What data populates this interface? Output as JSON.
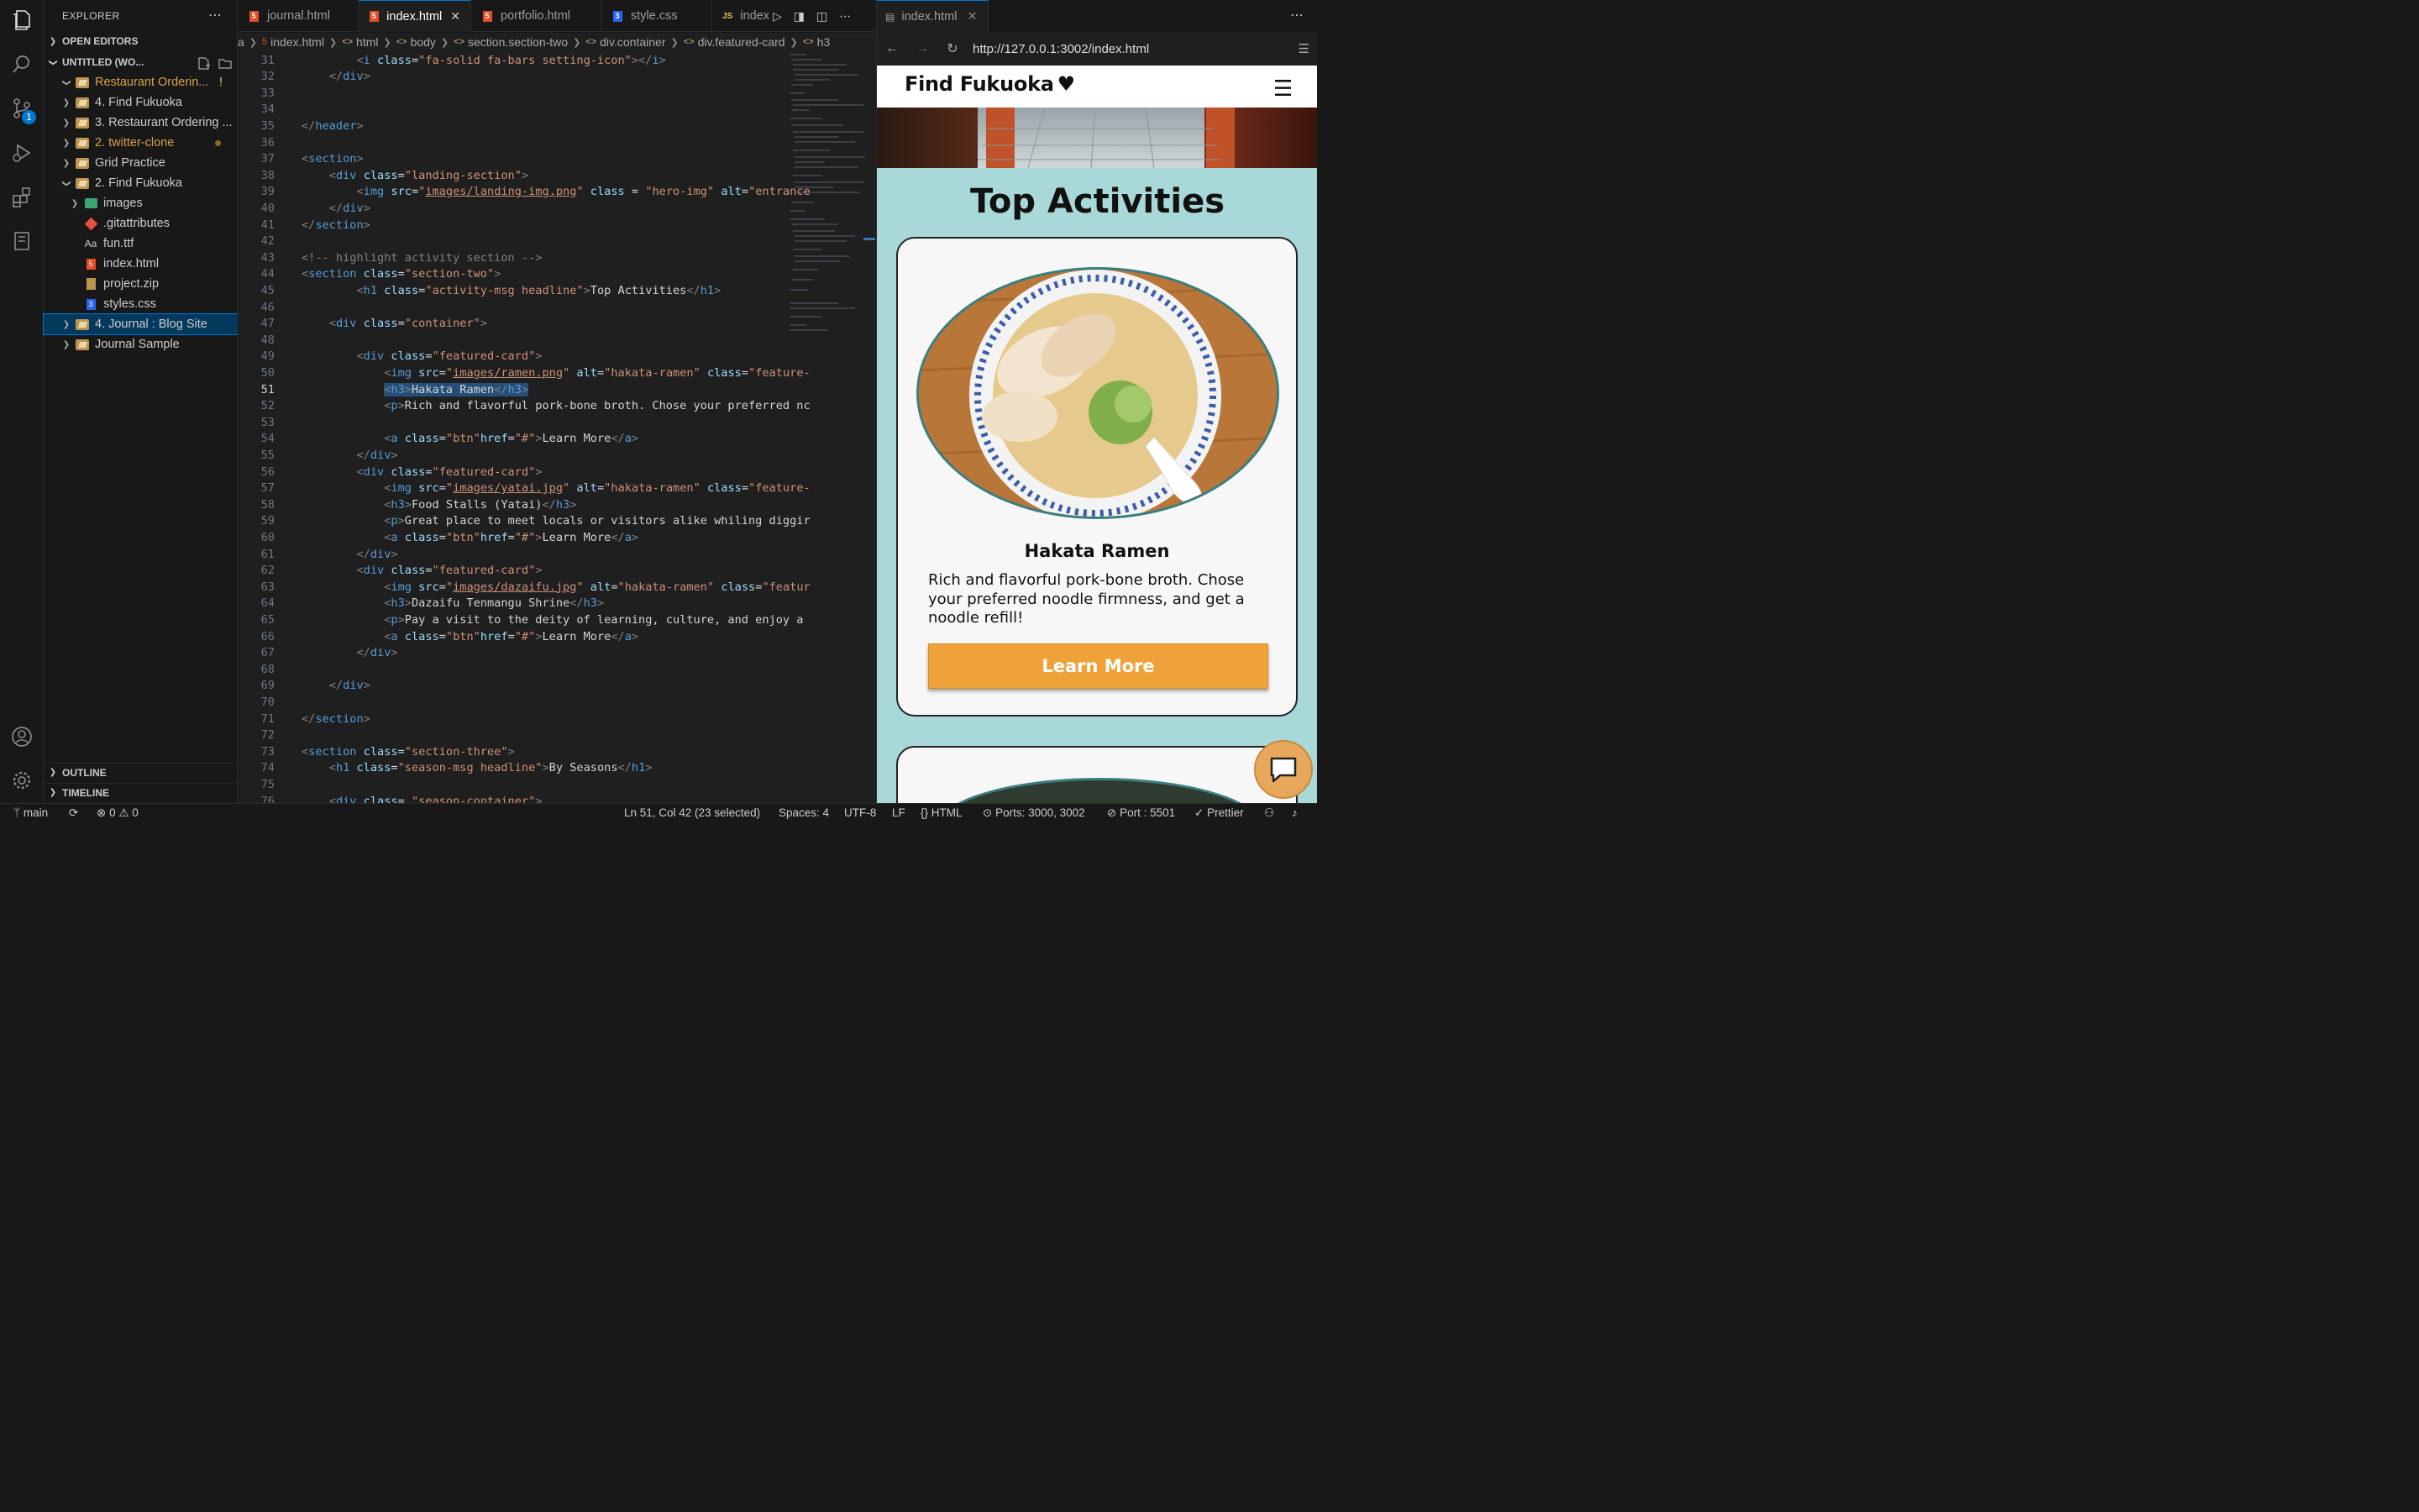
{
  "sidebar": {
    "title": "EXPLORER",
    "open_editors": "OPEN EDITORS",
    "workspace": "UNTITLED (WO...",
    "items": [
      {
        "label": "Restaurant Orderin...",
        "status": "!"
      },
      {
        "label": "4. Find Fukuoka"
      },
      {
        "label": "3. Restaurant Ordering ..."
      },
      {
        "label": "2. twitter-clone"
      },
      {
        "label": "Grid Practice"
      },
      {
        "label": "2. Find Fukuoka"
      },
      {
        "label": "images"
      },
      {
        "label": ".gitattributes"
      },
      {
        "label": "fun.ttf"
      },
      {
        "label": "index.html"
      },
      {
        "label": "project.zip"
      },
      {
        "label": "styles.css"
      },
      {
        "label": "4. Journal : Blog Site"
      },
      {
        "label": "Journal Sample"
      }
    ],
    "outline": "OUTLINE",
    "timeline": "TIMELINE",
    "source_control_badge": "1"
  },
  "tabs": [
    {
      "label": "journal.html",
      "icon": "html-icon"
    },
    {
      "label": "index.html",
      "icon": "html-icon",
      "active": true
    },
    {
      "label": "portfolio.html",
      "icon": "html-icon"
    },
    {
      "label": "style.css",
      "icon": "css-icon"
    },
    {
      "label": "index",
      "icon": "js-icon",
      "prefix": "JS"
    }
  ],
  "breadcrumbs": [
    "a",
    "index.html",
    "html",
    "body",
    "section.section-two",
    "div.container",
    "div.featured-card",
    "h3"
  ],
  "editor": {
    "lines": [
      {
        "n": 31,
        "html": "        <span class=\"t\">&lt;</span><span class=\"tg\">i</span> <span class=\"at\">class</span><span class=\"tx\">=</span><span class=\"st\">\"fa-solid fa-bars setting-icon\"</span><span class=\"t\">&gt;&lt;/</span><span class=\"tg\">i</span><span class=\"t\">&gt;</span>"
      },
      {
        "n": 32,
        "html": "    <span class=\"t\">&lt;/</span><span class=\"tg\">div</span><span class=\"t\">&gt;</span>"
      },
      {
        "n": 33,
        "html": ""
      },
      {
        "n": 34,
        "html": ""
      },
      {
        "n": 35,
        "html": "<span class=\"t\">&lt;/</span><span class=\"tg\">header</span><span class=\"t\">&gt;</span>"
      },
      {
        "n": 36,
        "html": ""
      },
      {
        "n": 37,
        "html": "<span class=\"t\">&lt;</span><span class=\"tg\">section</span><span class=\"t\">&gt;</span>"
      },
      {
        "n": 38,
        "html": "    <span class=\"t\">&lt;</span><span class=\"tg\">div</span> <span class=\"at\">class</span><span class=\"tx\">=</span><span class=\"st\">\"landing-section\"</span><span class=\"t\">&gt;</span>"
      },
      {
        "n": 39,
        "html": "        <span class=\"t\">&lt;</span><span class=\"tg\">img</span> <span class=\"at\">src</span><span class=\"tx\">=</span><span class=\"st\">\"</span><span class=\"lk\">images/landing-img.png</span><span class=\"st\">\"</span> <span class=\"at\">class</span> <span class=\"tx\">=</span> <span class=\"st\">\"hero-img\"</span> <span class=\"at\">alt</span><span class=\"tx\">=</span><span class=\"st\">\"entrance</span>"
      },
      {
        "n": 40,
        "html": "    <span class=\"t\">&lt;/</span><span class=\"tg\">div</span><span class=\"t\">&gt;</span>"
      },
      {
        "n": 41,
        "html": "<span class=\"t\">&lt;/</span><span class=\"tg\">section</span><span class=\"t\">&gt;</span>"
      },
      {
        "n": 42,
        "html": ""
      },
      {
        "n": 43,
        "html": "<span class=\"t\">&lt;!-- highlight activity section --&gt;</span>"
      },
      {
        "n": 44,
        "html": "<span class=\"t\">&lt;</span><span class=\"tg\">section</span> <span class=\"at\">class</span><span class=\"tx\">=</span><span class=\"st\">\"section-two\"</span><span class=\"t\">&gt;</span>"
      },
      {
        "n": 45,
        "html": "        <span class=\"t\">&lt;</span><span class=\"tg\">h1</span> <span class=\"at\">class</span><span class=\"tx\">=</span><span class=\"st\">\"activity-msg headline\"</span><span class=\"t\">&gt;</span><span class=\"tx\">Top Activities</span><span class=\"t\">&lt;/</span><span class=\"tg\">h1</span><span class=\"t\">&gt;</span>"
      },
      {
        "n": 46,
        "html": ""
      },
      {
        "n": 47,
        "html": "    <span class=\"t\">&lt;</span><span class=\"tg\">div</span> <span class=\"at\">class</span><span class=\"tx\">=</span><span class=\"st\">\"container\"</span><span class=\"t\">&gt;</span>"
      },
      {
        "n": 48,
        "html": ""
      },
      {
        "n": 49,
        "html": "        <span class=\"t\">&lt;</span><span class=\"tg\">div</span> <span class=\"at\">class</span><span class=\"tx\">=</span><span class=\"st\">\"featured-card\"</span><span class=\"t\">&gt;</span>"
      },
      {
        "n": 50,
        "html": "            <span class=\"t\">&lt;</span><span class=\"tg\">img</span> <span class=\"at\">src</span><span class=\"tx\">=</span><span class=\"st\">\"</span><span class=\"lk\">images/ramen.png</span><span class=\"st\">\"</span> <span class=\"at\">alt</span><span class=\"tx\">=</span><span class=\"st\">\"hakata-ramen\"</span> <span class=\"at\">class</span><span class=\"tx\">=</span><span class=\"st\">\"feature-</span>"
      },
      {
        "n": 51,
        "html": "            <span class=\"selbg\"><span class=\"t\">&lt;</span><span class=\"tg\">h3</span><span class=\"t\">&gt;</span><span class=\"tx\">Hakata Ramen</span><span class=\"t\">&lt;/</span><span class=\"tg\">h3</span><span class=\"t\">&gt;</span></span>",
        "current": true
      },
      {
        "n": 52,
        "html": "            <span class=\"t\">&lt;</span><span class=\"tg\">p</span><span class=\"t\">&gt;</span><span class=\"tx\">Rich and flavorful pork-bone broth. Chose your preferred nc</span>"
      },
      {
        "n": 53,
        "html": ""
      },
      {
        "n": 54,
        "html": "            <span class=\"t\">&lt;</span><span class=\"tg\">a</span> <span class=\"at\">class</span><span class=\"tx\">=</span><span class=\"st\">\"btn\"</span><span class=\"at\">href</span><span class=\"tx\">=</span><span class=\"st\">\"#\"</span><span class=\"t\">&gt;</span><span class=\"tx\">Learn More</span><span class=\"t\">&lt;/</span><span class=\"tg\">a</span><span class=\"t\">&gt;</span>"
      },
      {
        "n": 55,
        "html": "        <span class=\"t\">&lt;/</span><span class=\"tg\">div</span><span class=\"t\">&gt;</span>"
      },
      {
        "n": 56,
        "html": "        <span class=\"t\">&lt;</span><span class=\"tg\">div</span> <span class=\"at\">class</span><span class=\"tx\">=</span><span class=\"st\">\"featured-card\"</span><span class=\"t\">&gt;</span>"
      },
      {
        "n": 57,
        "html": "            <span class=\"t\">&lt;</span><span class=\"tg\">img</span> <span class=\"at\">src</span><span class=\"tx\">=</span><span class=\"st\">\"</span><span class=\"lk\">images/yatai.jpg</span><span class=\"st\">\"</span> <span class=\"at\">alt</span><span class=\"tx\">=</span><span class=\"st\">\"hakata-ramen\"</span> <span class=\"at\">class</span><span class=\"tx\">=</span><span class=\"st\">\"feature-</span>"
      },
      {
        "n": 58,
        "html": "            <span class=\"t\">&lt;</span><span class=\"tg\">h3</span><span class=\"t\">&gt;</span><span class=\"tx\">Food Stalls (Yatai)</span><span class=\"t\">&lt;/</span><span class=\"tg\">h3</span><span class=\"t\">&gt;</span>"
      },
      {
        "n": 59,
        "html": "            <span class=\"t\">&lt;</span><span class=\"tg\">p</span><span class=\"t\">&gt;</span><span class=\"tx\">Great place to meet locals or visitors alike whiling diggir</span>"
      },
      {
        "n": 60,
        "html": "            <span class=\"t\">&lt;</span><span class=\"tg\">a</span> <span class=\"at\">class</span><span class=\"tx\">=</span><span class=\"st\">\"btn\"</span><span class=\"at\">href</span><span class=\"tx\">=</span><span class=\"st\">\"#\"</span><span class=\"t\">&gt;</span><span class=\"tx\">Learn More</span><span class=\"t\">&lt;/</span><span class=\"tg\">a</span><span class=\"t\">&gt;</span>"
      },
      {
        "n": 61,
        "html": "        <span class=\"t\">&lt;/</span><span class=\"tg\">div</span><span class=\"t\">&gt;</span>"
      },
      {
        "n": 62,
        "html": "        <span class=\"t\">&lt;</span><span class=\"tg\">div</span> <span class=\"at\">class</span><span class=\"tx\">=</span><span class=\"st\">\"featured-card\"</span><span class=\"t\">&gt;</span>"
      },
      {
        "n": 63,
        "html": "            <span class=\"t\">&lt;</span><span class=\"tg\">img</span> <span class=\"at\">src</span><span class=\"tx\">=</span><span class=\"st\">\"</span><span class=\"lk\">images/dazaifu.jpg</span><span class=\"st\">\"</span> <span class=\"at\">alt</span><span class=\"tx\">=</span><span class=\"st\">\"hakata-ramen\"</span> <span class=\"at\">class</span><span class=\"tx\">=</span><span class=\"st\">\"featur</span>"
      },
      {
        "n": 64,
        "html": "            <span class=\"t\">&lt;</span><span class=\"tg\">h3</span><span class=\"t\">&gt;</span><span class=\"tx\">Dazaifu Tenmangu Shrine</span><span class=\"t\">&lt;/</span><span class=\"tg\">h3</span><span class=\"t\">&gt;</span>"
      },
      {
        "n": 65,
        "html": "            <span class=\"t\">&lt;</span><span class=\"tg\">p</span><span class=\"t\">&gt;</span><span class=\"tx\">Pay a visit to the deity of learning, culture, and enjoy a</span>"
      },
      {
        "n": 66,
        "html": "            <span class=\"t\">&lt;</span><span class=\"tg\">a</span> <span class=\"at\">class</span><span class=\"tx\">=</span><span class=\"st\">\"btn\"</span><span class=\"at\">href</span><span class=\"tx\">=</span><span class=\"st\">\"#\"</span><span class=\"t\">&gt;</span><span class=\"tx\">Learn More</span><span class=\"t\">&lt;/</span><span class=\"tg\">a</span><span class=\"t\">&gt;</span>"
      },
      {
        "n": 67,
        "html": "        <span class=\"t\">&lt;/</span><span class=\"tg\">div</span><span class=\"t\">&gt;</span>"
      },
      {
        "n": 68,
        "html": ""
      },
      {
        "n": 69,
        "html": "    <span class=\"t\">&lt;/</span><span class=\"tg\">div</span><span class=\"t\">&gt;</span>"
      },
      {
        "n": 70,
        "html": ""
      },
      {
        "n": 71,
        "html": "<span class=\"t\">&lt;/</span><span class=\"tg\">section</span><span class=\"t\">&gt;</span>"
      },
      {
        "n": 72,
        "html": ""
      },
      {
        "n": 73,
        "html": "<span class=\"t\">&lt;</span><span class=\"tg\">section</span> <span class=\"at\">class</span><span class=\"tx\">=</span><span class=\"st\">\"section-three\"</span><span class=\"t\">&gt;</span>"
      },
      {
        "n": 74,
        "html": "    <span class=\"t\">&lt;</span><span class=\"tg\">h1</span> <span class=\"at\">class</span><span class=\"tx\">=</span><span class=\"st\">\"season-msg headline\"</span><span class=\"t\">&gt;</span><span class=\"tx\">By Seasons</span><span class=\"t\">&lt;/</span><span class=\"tg\">h1</span><span class=\"t\">&gt;</span>"
      },
      {
        "n": 75,
        "html": ""
      },
      {
        "n": 76,
        "html": "    <span class=\"t\">&lt;</span><span class=\"tg\">div</span> <span class=\"at\">class</span><span class=\"tx\">= </span><span class=\"st\">\"season-container\"</span><span class=\"t\">&gt;</span>"
      }
    ]
  },
  "browser": {
    "tab_label": "index.html",
    "url": "http://127.0.0.1:3002/index.html",
    "site_brand": "Find Fukuoka",
    "page_title": "Top Activities",
    "card_title": "Hakata Ramen",
    "card_desc": "Rich and flavorful pork-bone broth. Chose your preferred noodle firmness, and get a noodle refill!",
    "card_button": "Learn More"
  },
  "statusbar": {
    "branch": "main",
    "errors": "0",
    "warnings": "0",
    "cursor": "Ln 51, Col 42 (23 selected)",
    "spaces": "Spaces: 4",
    "encoding": "UTF-8",
    "eol": "LF",
    "language": "HTML",
    "ports": "Ports: 3000, 3002",
    "port": "Port : 5501",
    "prettier": "Prettier"
  }
}
